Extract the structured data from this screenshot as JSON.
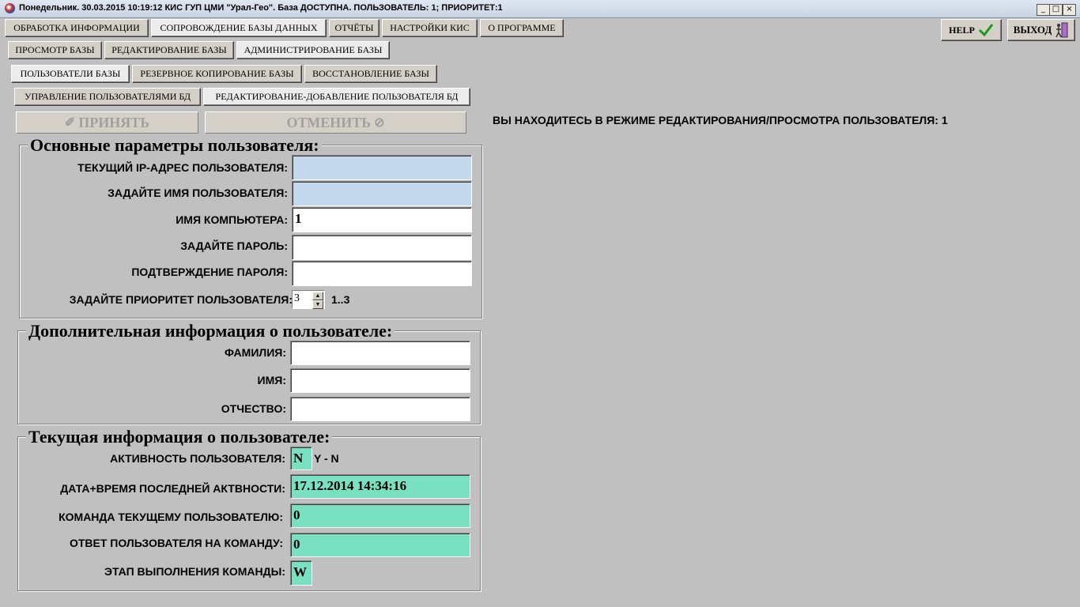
{
  "window": {
    "title": "Понедельник. 30.03.2015 10:19:12 КИС ГУП ЦМИ \"Урал-Гео\". База ДОСТУПНА. ПОЛЬЗОВАТЕЛЬ: 1; ПРИОРИТЕТ:1",
    "minimize": "_",
    "maximize": "□",
    "close": "×"
  },
  "menu": {
    "items": [
      "ОБРАБОТКА ИНФОРМАЦИИ",
      "СОПРОВОЖДЕНИЕ БАЗЫ ДАННЫХ",
      "ОТЧЁТЫ",
      "НАСТРОЙКИ КИС",
      "О ПРОГРАММЕ"
    ],
    "help": "HELP",
    "exit": "ВЫХОД"
  },
  "sub1": [
    "ПРОСМОТР БАЗЫ",
    "РЕДАКТИРОВАНИЕ БАЗЫ",
    "АДМИНИСТРИРОВАНИЕ БАЗЫ"
  ],
  "sub2": [
    "ПОЛЬЗОВАТЕЛИ БАЗЫ",
    "РЕЗЕРВНОЕ КОПИРОВАНИЕ БАЗЫ",
    "ВОССТАНОВЛЕНИЕ БАЗЫ"
  ],
  "sub3": [
    "УПРАВЛЕНИЕ ПОЛЬЗОВАТЕЛЯМИ БД",
    "РЕДАКТИРОВАНИЕ-ДОБАВЛЕНИЕ  ПОЛЬЗОВАТЕЛЯ БД"
  ],
  "actions": {
    "accept": "ПРИНЯТЬ",
    "cancel": "ОТМЕНИТЬ"
  },
  "mode_message": "ВЫ НАХОДИТЕСЬ В РЕЖИМЕ РЕДАКТИРОВАНИЯ/ПРОСМОТРА ПОЛЬЗОВАТЕЛЯ: 1",
  "basic": {
    "title": "Основные параметры пользователя:",
    "ip_label": "ТЕКУЩИЙ IP-АДРЕС ПОЛЬЗОВАТЕЛЯ:",
    "ip_value": "",
    "name_label": "ЗАДАЙТЕ ИМЯ ПОЛЬЗОВАТЕЛЯ:",
    "name_value": "",
    "computer_label": "ИМЯ КОМПЬЮТЕРА:",
    "computer_value": "1",
    "password_label": "ЗАДАЙТЕ ПАРОЛЬ:",
    "password_value": "",
    "confirm_label": "ПОДТВЕРЖДЕНИЕ ПАРОЛЯ:",
    "confirm_value": "",
    "priority_label": "ЗАДАЙТЕ ПРИОРИТЕТ ПОЛЬЗОВАТЕЛЯ:",
    "priority_value": "3",
    "priority_range": "1..3"
  },
  "extra": {
    "title": "Дополнительная информация о пользователе:",
    "surname_label": "ФАМИЛИЯ:",
    "surname_value": "",
    "firstname_label": "ИМЯ:",
    "firstname_value": "",
    "patronymic_label": "ОТЧЕСТВО:",
    "patronymic_value": ""
  },
  "current": {
    "title": "Текущая информация о пользователе:",
    "activity_label": "АКТИВНОСТЬ ПОЛЬЗОВАТЕЛЯ:",
    "activity_value": "N",
    "activity_hint": "Y - N",
    "last_label": "ДАТА+ВРЕМЯ ПОСЛЕДНЕЙ АКТВНОСТИ:",
    "last_value": "17.12.2014 14:34:16",
    "command_label": "КОМАНДА ТЕКУЩЕМУ ПОЛЬЗОВАТЕЛЮ:",
    "command_value": "0",
    "answer_label": "ОТВЕТ ПОЛЬЗОВАТЕЛЯ НА КОМАНДУ:",
    "answer_value": "0",
    "stage_label": "ЭТАП ВЫПОЛНЕНИЯ КОМАНДЫ:",
    "stage_value": "W"
  }
}
